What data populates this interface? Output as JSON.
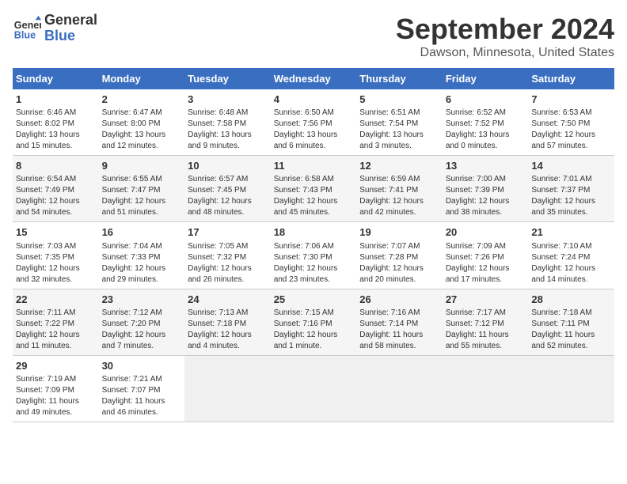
{
  "header": {
    "logo_line1": "General",
    "logo_line2": "Blue",
    "month": "September 2024",
    "location": "Dawson, Minnesota, United States"
  },
  "days_of_week": [
    "Sunday",
    "Monday",
    "Tuesday",
    "Wednesday",
    "Thursday",
    "Friday",
    "Saturday"
  ],
  "weeks": [
    [
      {
        "day": "1",
        "info": "Sunrise: 6:46 AM\nSunset: 8:02 PM\nDaylight: 13 hours\nand 15 minutes."
      },
      {
        "day": "2",
        "info": "Sunrise: 6:47 AM\nSunset: 8:00 PM\nDaylight: 13 hours\nand 12 minutes."
      },
      {
        "day": "3",
        "info": "Sunrise: 6:48 AM\nSunset: 7:58 PM\nDaylight: 13 hours\nand 9 minutes."
      },
      {
        "day": "4",
        "info": "Sunrise: 6:50 AM\nSunset: 7:56 PM\nDaylight: 13 hours\nand 6 minutes."
      },
      {
        "day": "5",
        "info": "Sunrise: 6:51 AM\nSunset: 7:54 PM\nDaylight: 13 hours\nand 3 minutes."
      },
      {
        "day": "6",
        "info": "Sunrise: 6:52 AM\nSunset: 7:52 PM\nDaylight: 13 hours\nand 0 minutes."
      },
      {
        "day": "7",
        "info": "Sunrise: 6:53 AM\nSunset: 7:50 PM\nDaylight: 12 hours\nand 57 minutes."
      }
    ],
    [
      {
        "day": "8",
        "info": "Sunrise: 6:54 AM\nSunset: 7:49 PM\nDaylight: 12 hours\nand 54 minutes."
      },
      {
        "day": "9",
        "info": "Sunrise: 6:55 AM\nSunset: 7:47 PM\nDaylight: 12 hours\nand 51 minutes."
      },
      {
        "day": "10",
        "info": "Sunrise: 6:57 AM\nSunset: 7:45 PM\nDaylight: 12 hours\nand 48 minutes."
      },
      {
        "day": "11",
        "info": "Sunrise: 6:58 AM\nSunset: 7:43 PM\nDaylight: 12 hours\nand 45 minutes."
      },
      {
        "day": "12",
        "info": "Sunrise: 6:59 AM\nSunset: 7:41 PM\nDaylight: 12 hours\nand 42 minutes."
      },
      {
        "day": "13",
        "info": "Sunrise: 7:00 AM\nSunset: 7:39 PM\nDaylight: 12 hours\nand 38 minutes."
      },
      {
        "day": "14",
        "info": "Sunrise: 7:01 AM\nSunset: 7:37 PM\nDaylight: 12 hours\nand 35 minutes."
      }
    ],
    [
      {
        "day": "15",
        "info": "Sunrise: 7:03 AM\nSunset: 7:35 PM\nDaylight: 12 hours\nand 32 minutes."
      },
      {
        "day": "16",
        "info": "Sunrise: 7:04 AM\nSunset: 7:33 PM\nDaylight: 12 hours\nand 29 minutes."
      },
      {
        "day": "17",
        "info": "Sunrise: 7:05 AM\nSunset: 7:32 PM\nDaylight: 12 hours\nand 26 minutes."
      },
      {
        "day": "18",
        "info": "Sunrise: 7:06 AM\nSunset: 7:30 PM\nDaylight: 12 hours\nand 23 minutes."
      },
      {
        "day": "19",
        "info": "Sunrise: 7:07 AM\nSunset: 7:28 PM\nDaylight: 12 hours\nand 20 minutes."
      },
      {
        "day": "20",
        "info": "Sunrise: 7:09 AM\nSunset: 7:26 PM\nDaylight: 12 hours\nand 17 minutes."
      },
      {
        "day": "21",
        "info": "Sunrise: 7:10 AM\nSunset: 7:24 PM\nDaylight: 12 hours\nand 14 minutes."
      }
    ],
    [
      {
        "day": "22",
        "info": "Sunrise: 7:11 AM\nSunset: 7:22 PM\nDaylight: 12 hours\nand 11 minutes."
      },
      {
        "day": "23",
        "info": "Sunrise: 7:12 AM\nSunset: 7:20 PM\nDaylight: 12 hours\nand 7 minutes."
      },
      {
        "day": "24",
        "info": "Sunrise: 7:13 AM\nSunset: 7:18 PM\nDaylight: 12 hours\nand 4 minutes."
      },
      {
        "day": "25",
        "info": "Sunrise: 7:15 AM\nSunset: 7:16 PM\nDaylight: 12 hours\nand 1 minute."
      },
      {
        "day": "26",
        "info": "Sunrise: 7:16 AM\nSunset: 7:14 PM\nDaylight: 11 hours\nand 58 minutes."
      },
      {
        "day": "27",
        "info": "Sunrise: 7:17 AM\nSunset: 7:12 PM\nDaylight: 11 hours\nand 55 minutes."
      },
      {
        "day": "28",
        "info": "Sunrise: 7:18 AM\nSunset: 7:11 PM\nDaylight: 11 hours\nand 52 minutes."
      }
    ],
    [
      {
        "day": "29",
        "info": "Sunrise: 7:19 AM\nSunset: 7:09 PM\nDaylight: 11 hours\nand 49 minutes."
      },
      {
        "day": "30",
        "info": "Sunrise: 7:21 AM\nSunset: 7:07 PM\nDaylight: 11 hours\nand 46 minutes."
      },
      {
        "day": "",
        "info": ""
      },
      {
        "day": "",
        "info": ""
      },
      {
        "day": "",
        "info": ""
      },
      {
        "day": "",
        "info": ""
      },
      {
        "day": "",
        "info": ""
      }
    ]
  ]
}
